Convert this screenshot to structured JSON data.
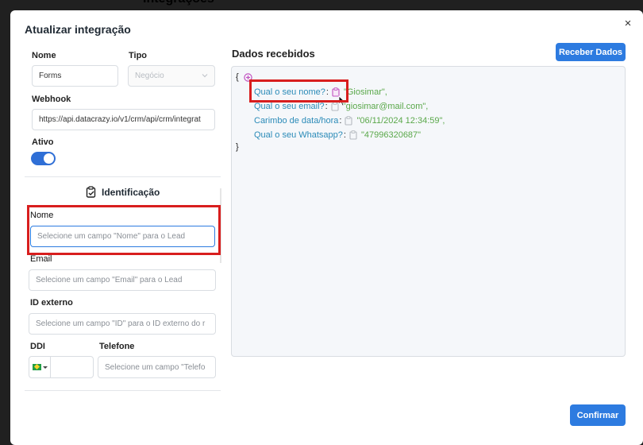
{
  "background": {
    "title": "Integrações"
  },
  "modal": {
    "title": "Atualizar integração",
    "close_symbol": "×"
  },
  "form": {
    "nome_label": "Nome",
    "nome_value": "Forms",
    "tipo_label": "Tipo",
    "tipo_value": "Negócio",
    "webhook_label": "Webhook",
    "webhook_value": "https://api.datacrazy.io/v1/crm/api/crm/integrat",
    "ativo_label": "Ativo",
    "ativo_on": true
  },
  "identificacao": {
    "title": "Identificação",
    "nome_label": "Nome",
    "nome_placeholder": "Selecione um campo \"Nome\" para o Lead",
    "email_label": "Email",
    "email_placeholder": "Selecione um campo \"Email\" para o Lead",
    "id_label": "ID externo",
    "id_placeholder": "Selecione um campo \"ID\" para o ID externo do r",
    "ddi_label": "DDI",
    "telefone_label": "Telefone",
    "telefone_placeholder": "Selecione um campo \"Telefo"
  },
  "dados": {
    "title": "Dados recebidos",
    "receive_button": "Receber Dados",
    "open_brace": "{",
    "close_brace": "}",
    "fields": [
      {
        "key": "Qual o seu nome?",
        "value": "\"Giosimar\","
      },
      {
        "key": "Qual o seu email?",
        "value": "\"giosimar@mail.com\","
      },
      {
        "key": "Carimbo de data/hora",
        "value": "\"06/11/2024 12:34:59\","
      },
      {
        "key": "Qual o seu Whatsapp?",
        "value": "\"47996320687\""
      }
    ]
  },
  "footer": {
    "confirm_button": "Confirmar"
  },
  "colors": {
    "accent": "#2d7be0",
    "highlight": "#d81e1e",
    "json_key": "#2b8bb8",
    "json_value": "#5aa84a"
  },
  "icons": [
    "close-icon",
    "chevron-down-icon",
    "clipboard-check-icon",
    "plus-circle-icon",
    "copy-icon",
    "cursor-icon",
    "brazil-flag-icon"
  ]
}
